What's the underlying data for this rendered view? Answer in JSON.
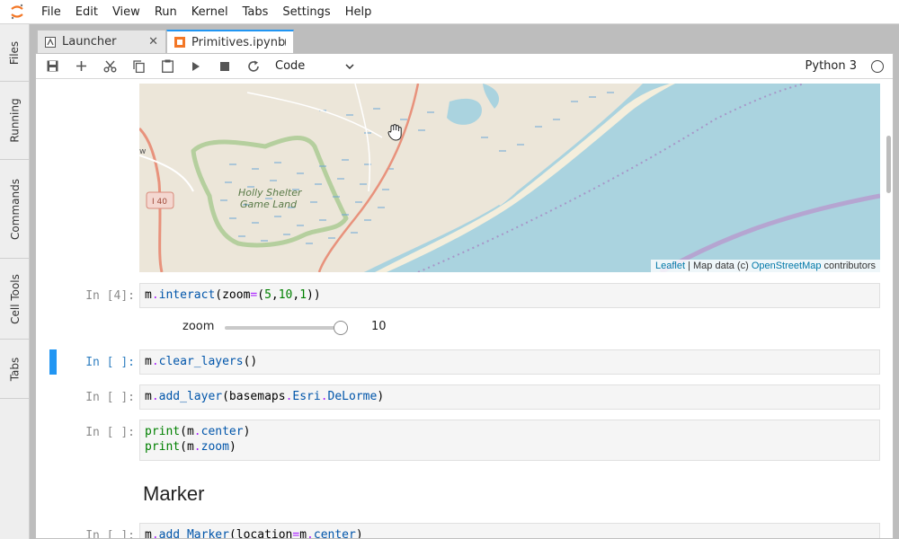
{
  "menubar": {
    "items": [
      "File",
      "Edit",
      "View",
      "Run",
      "Kernel",
      "Tabs",
      "Settings",
      "Help"
    ]
  },
  "sidebar": {
    "tabs": [
      "Files",
      "Running",
      "Commands",
      "Cell Tools",
      "Tabs"
    ]
  },
  "tabs": [
    {
      "label": "Launcher",
      "icon": "launcher-icon",
      "action": "close-icon"
    },
    {
      "label": "Primitives.ipynb",
      "icon": "notebook-icon",
      "action": "unsaved-dot"
    }
  ],
  "toolbar": {
    "icons": [
      "save-icon",
      "add-cell-icon",
      "cut-icon",
      "copy-icon",
      "paste-icon",
      "run-icon",
      "stop-icon",
      "restart-icon"
    ],
    "cell_type": "Code",
    "kernel_name": "Python 3"
  },
  "map": {
    "labels": {
      "park_line1": "Holly Shelter",
      "park_line2": "Game Land",
      "road_shield": "I 40",
      "edge_letter": "w"
    },
    "attribution": {
      "leaflet": "Leaflet",
      "sep": " | Map data (c) ",
      "osm": "OpenStreetMap",
      "suffix": " contributors"
    },
    "colors": {
      "land": "#ece6d9",
      "water": "#aad3df",
      "park": "#b5cf9e",
      "highway": "#e8927c"
    }
  },
  "cells": [
    {
      "prompt": "In [4]:",
      "code": "m.interact(zoom=(5,10,1))"
    },
    {
      "prompt": "In [ ]:",
      "code": "m.clear_layers()"
    },
    {
      "prompt": "In [ ]:",
      "code": "m.add_layer(basemaps.Esri.DeLorme)"
    },
    {
      "prompt": "In [ ]:",
      "code": "print(m.center)\nprint(m.zoom)"
    },
    {
      "prompt": "In [ ]:",
      "code": "m.add_Marker(location=m.center)"
    }
  ],
  "slider": {
    "label": "zoom",
    "value": "10",
    "min": 5,
    "max": 10,
    "fraction": 1.0
  },
  "markdown": {
    "heading": "Marker"
  },
  "colors": {
    "accent": "#2196f3",
    "prompt_active": "#307fc1"
  }
}
